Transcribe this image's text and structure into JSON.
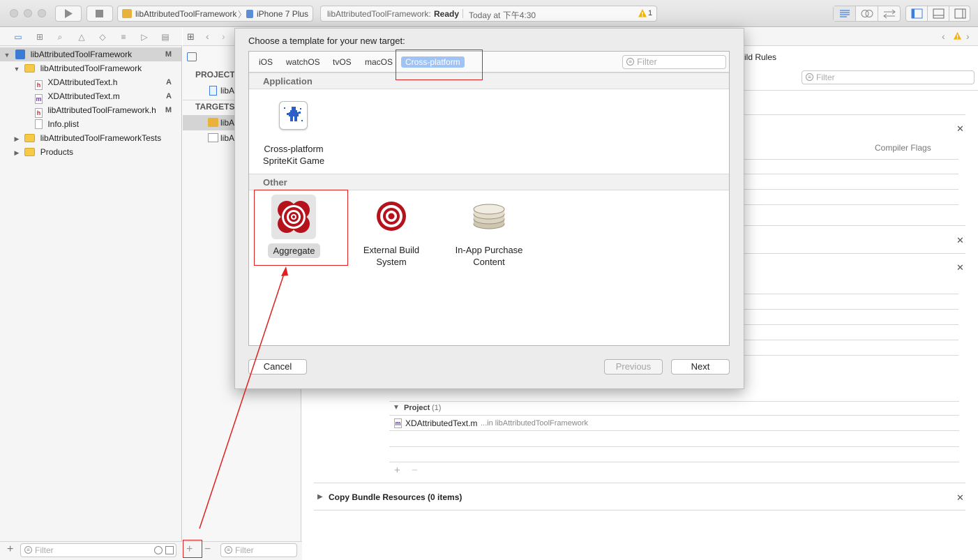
{
  "toolbar": {
    "scheme_target": "libAttributedToolFramework",
    "scheme_device": "iPhone 7 Plus",
    "status_project": "libAttributedToolFramework:",
    "status_state": "Ready",
    "status_time": "Today at 下午4:30",
    "warning_count": "1"
  },
  "navigator": {
    "items": [
      {
        "label": "libAttributedToolFramework",
        "badge": "M"
      },
      {
        "label": "libAttributedToolFramework",
        "badge": ""
      },
      {
        "label": "XDAttributedText.h",
        "badge": "A"
      },
      {
        "label": "XDAttributedText.m",
        "badge": "A"
      },
      {
        "label": "libAttributedToolFramework.h",
        "badge": "M"
      },
      {
        "label": "Info.plist",
        "badge": ""
      },
      {
        "label": "libAttributedToolFrameworkTests",
        "badge": ""
      },
      {
        "label": "Products",
        "badge": ""
      }
    ],
    "filter_placeholder": "Filter"
  },
  "targets": {
    "project_header": "PROJECT",
    "project_item": "libA",
    "targets_header": "TARGETS",
    "target_items": [
      "libA",
      "libA"
    ],
    "filter_placeholder": "Filter",
    "add_label": "+",
    "remove_label": "−"
  },
  "editor": {
    "build_rules_tab": "ild Rules",
    "filter_placeholder": "Filter",
    "compiler_flags": "Compiler Flags",
    "project_group": "Project",
    "project_count": "(1)",
    "file_name": "XDAttributedText.m",
    "file_location": "...in libAttributedToolFramework",
    "copy_bundle": "Copy Bundle Resources (0 items)"
  },
  "sheet": {
    "title": "Choose a template for your new target:",
    "platform_tabs": [
      "iOS",
      "watchOS",
      "tvOS",
      "macOS",
      "Cross-platform"
    ],
    "selected_platform": "Cross-platform",
    "filter_placeholder": "Filter",
    "sections": [
      {
        "name": "Application",
        "templates": [
          {
            "line1": "Cross-platform",
            "line2": "SpriteKit Game"
          }
        ]
      },
      {
        "name": "Other",
        "templates": [
          {
            "line1": "Aggregate",
            "line2": ""
          },
          {
            "line1": "External Build",
            "line2": "System"
          },
          {
            "line1": "In-App Purchase",
            "line2": "Content"
          }
        ]
      }
    ],
    "selected_template": "Aggregate",
    "cancel_label": "Cancel",
    "previous_label": "Previous",
    "next_label": "Next"
  },
  "colors": {
    "annotation_red": "#e02020",
    "selected_tab": "#9fc3f5",
    "target_red": "#b5121b"
  }
}
